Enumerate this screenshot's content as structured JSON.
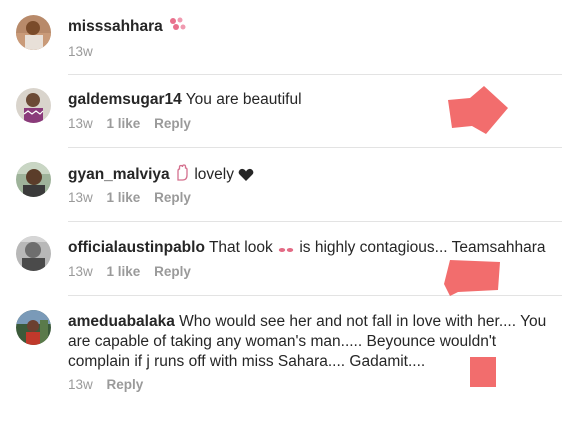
{
  "comments": [
    {
      "username": "misssahhara",
      "text": "",
      "time": "13w",
      "likes": "",
      "reply": ""
    },
    {
      "username": "galdemsugar14",
      "text": "You are beautiful",
      "time": "13w",
      "likes": "1 like",
      "reply": "Reply"
    },
    {
      "username": "gyan_malviya",
      "text": "lovely",
      "time": "13w",
      "likes": "1 like",
      "reply": "Reply"
    },
    {
      "username": "officialaustinpablo",
      "text_before": "That look",
      "text_after": "is highly contagious... Teamsahhara",
      "time": "13w",
      "likes": "1 like",
      "reply": "Reply"
    },
    {
      "username": "ameduabalaka",
      "text": "Who would see her and not fall in love with her.... You are capable of taking any woman's man..... Beyounce wouldn't complain if j runs off with miss Sahara.... Gadamit....",
      "time": "13w",
      "likes": "",
      "reply": "Reply"
    }
  ],
  "colors": {
    "username": "#262626",
    "meta": "#9a9a9a",
    "divider": "#e3e3e3",
    "redaction": "#f26d6d",
    "heart": "#262626"
  },
  "icons": {
    "comment1_emoji": "pink-flowers-icon",
    "comment3_emoji_1": "raised-hand-icon",
    "comment3_emoji_2": "heart-icon",
    "comment4_emoji": "eyes-icon"
  }
}
